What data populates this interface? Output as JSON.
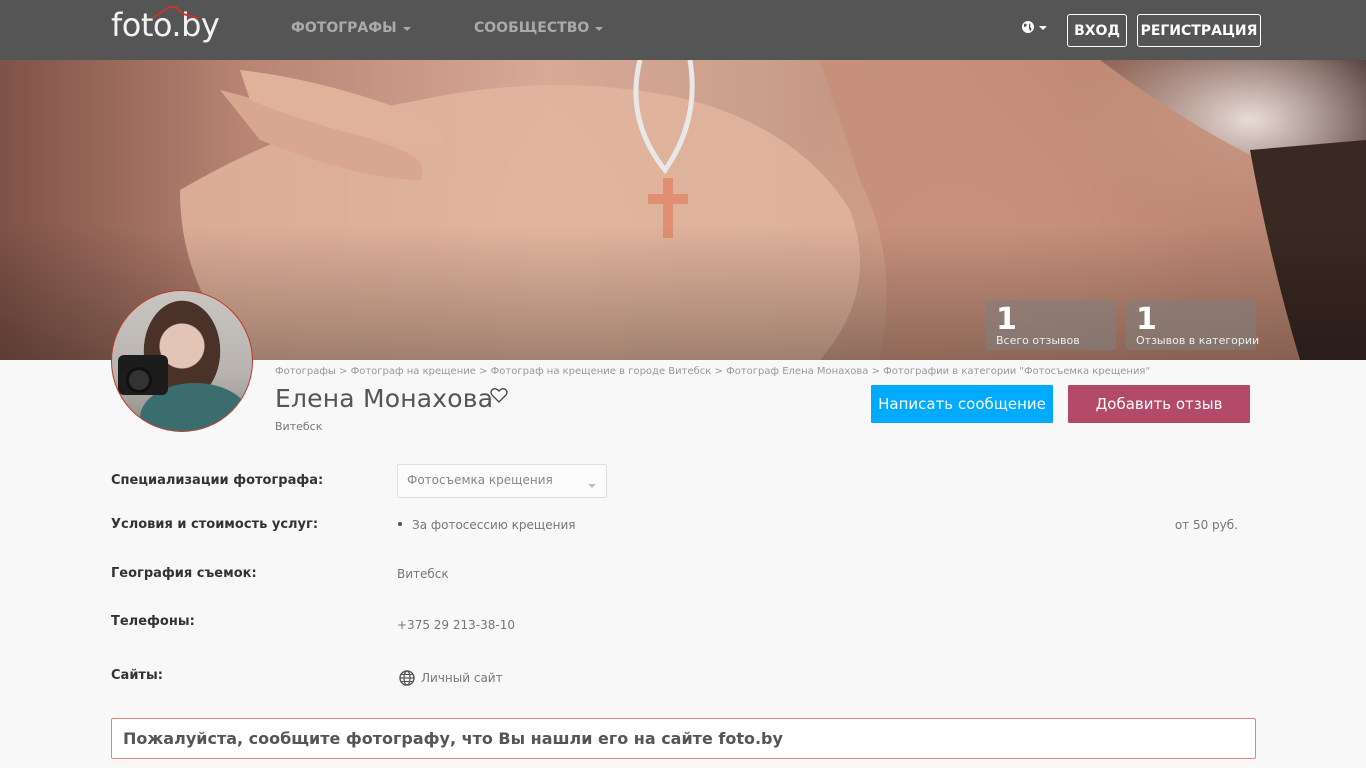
{
  "nav": {
    "logo": "foto.by",
    "menu_photographers": "ФОТОГРАФЫ",
    "menu_community": "СООБЩЕСТВО",
    "login": "ВХОД",
    "register": "РЕГИСТРАЦИЯ"
  },
  "stats": [
    {
      "value": "1",
      "label": "Всего отзывов"
    },
    {
      "value": "1",
      "label": "Отзывов в категории"
    }
  ],
  "breadcrumb": {
    "items": [
      "Фотографы",
      "Фотограф на крещение",
      "Фотограф на крещение в городе Витебск",
      "Фотограф Елена Монахова",
      "Фотографии в категории \"Фотосъемка крещения\""
    ],
    "separator": ">"
  },
  "profile": {
    "name": "Елена Монахова",
    "city": "Витебск"
  },
  "actions": {
    "write_message": "Написать сообщение",
    "add_review": "Добавить отзыв",
    "write_color": "#00aaff",
    "review_color": "#b34a6a"
  },
  "info": {
    "specializations": {
      "label": "Специализации фотографа:",
      "selected": "Фотосъемка крещения"
    },
    "services": {
      "label": "Условия и стоимость услуг:",
      "item": "За фотосессию крещения",
      "price": "от 50 руб."
    },
    "geography": {
      "label": "География съемок:",
      "value": "Витебск"
    },
    "phones": {
      "label": "Телефоны:",
      "value": "+375 29 213-38-10"
    },
    "sites": {
      "label": "Сайты:",
      "link": "Личный сайт"
    }
  },
  "notice": "Пожалуйста, сообщите фотографу, что Вы нашли его на сайте foto.by"
}
